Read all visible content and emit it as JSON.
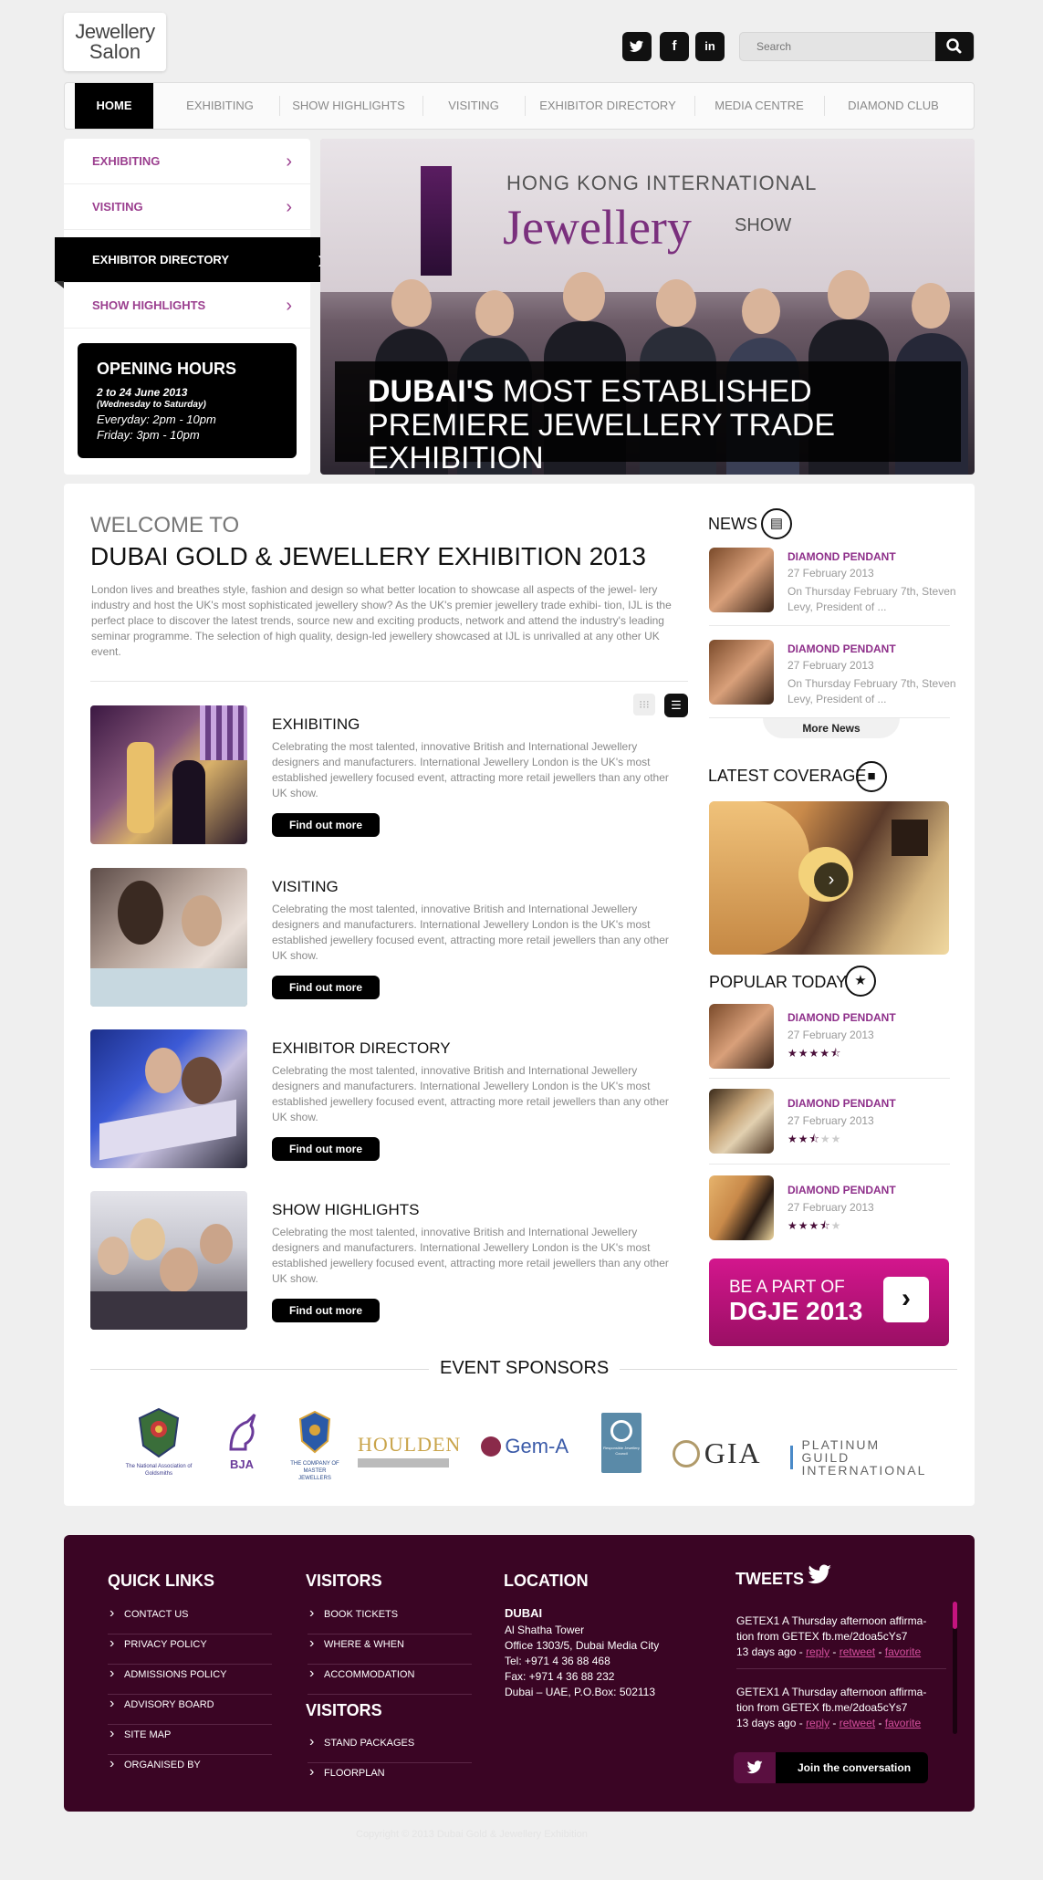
{
  "header": {
    "logo_line1": "Jewellery",
    "logo_line2": "Salon",
    "social": [
      "twitter",
      "facebook",
      "linkedin"
    ],
    "search_placeholder": "Search"
  },
  "nav": {
    "items": [
      "HOME",
      "EXHIBITING",
      "SHOW HIGHLIGHTS",
      "VISITING",
      "EXHIBITOR DIRECTORY",
      "MEDIA CENTRE",
      "DIAMOND CLUB"
    ],
    "active": "HOME"
  },
  "left_menu": {
    "items": [
      "EXHIBITING",
      "VISITING",
      "EXHIBITOR DIRECTORY",
      "SHOW HIGHLIGHTS"
    ],
    "active": "EXHIBITOR DIRECTORY"
  },
  "opening_hours": {
    "title": "OPENING HOURS",
    "dates": "2 to 24 June 2013",
    "sub": "(Wednesday to Saturday)",
    "everyday": "Everyday: 2pm - 10pm",
    "friday": "Friday: 3pm - 10pm"
  },
  "hero": {
    "banner_small": "HONG KONG INTERNATIONAL",
    "banner_big": "Jewellery",
    "banner_show": "SHOW",
    "line1_bold": "DUBAI'S",
    "line1_rest": " MOST ESTABLISHED",
    "line2": "PREMIERE JEWELLERY TRADE EXHIBITION"
  },
  "welcome": {
    "small": "WELCOME TO",
    "big": "DUBAI GOLD & JEWELLERY EXHIBITION 2013",
    "intro": "London lives and breathes style, fashion and design so what better location to showcase all aspects of the jewel- lery industry and host the UK's most sophisticated jewellery show? As the UK's premier jewellery trade exhibi- tion, IJL is the perfect place to discover the latest trends, source new and exciting products, network and attend the industry's leading seminar programme. The selection of high quality, design-led jewellery showcased at IJL is unrivalled at any other UK event."
  },
  "features": [
    {
      "title": "EXHIBITING",
      "desc": "Celebrating the most talented, innovative British and International Jewellery designers and manufacturers. International Jewellery London is the UK's most established jewellery focused event, attracting more retail jewellers than any other UK show.",
      "button": "Find out more"
    },
    {
      "title": "VISITING",
      "desc": "Celebrating the most talented, innovative British and International Jewellery designers and manufacturers. International Jewellery London is the UK's most established jewellery focused event, attracting more retail jewellers than any other UK show.",
      "button": "Find out more"
    },
    {
      "title": "EXHIBITOR DIRECTORY",
      "desc": "Celebrating the most talented, innovative British and International Jewellery designers and manufacturers. International Jewellery London is the UK's most established jewellery focused event, attracting more retail jewellers than any other UK show.",
      "button": "Find out more"
    },
    {
      "title": "SHOW HIGHLIGHTS",
      "desc": "Celebrating the most talented, innovative British and International Jewellery designers and manufacturers. International Jewellery London is the UK's most established jewellery focused event, attracting more retail jewellers than any other UK show.",
      "button": "Find out more"
    }
  ],
  "news": {
    "title": "NEWS",
    "items": [
      {
        "title": "DIAMOND PENDANT",
        "date": "27 February 2013",
        "excerpt": "On Thursday February 7th, Steven Levy, President of ..."
      },
      {
        "title": "DIAMOND PENDANT",
        "date": "27 February 2013",
        "excerpt": "On Thursday February 7th, Steven Levy, President of ..."
      }
    ],
    "more": "More News"
  },
  "coverage": {
    "title": "LATEST COVERAGE"
  },
  "popular": {
    "title": "POPULAR TODAY",
    "items": [
      {
        "title": "DIAMOND PENDANT",
        "date": "27 February 2013",
        "rating": 4.5
      },
      {
        "title": "DIAMOND PENDANT",
        "date": "27 February 2013",
        "rating": 2.5
      },
      {
        "title": "DIAMOND PENDANT",
        "date": "27 February 2013",
        "rating": 3.5
      }
    ]
  },
  "cta": {
    "line1": "BE A PART OF",
    "line2": "DGJE 2013"
  },
  "sponsors": {
    "title": "EVENT SPONSORS",
    "items": [
      "The National Association of Goldsmiths",
      "BJA",
      "THE COMPANY OF MASTER JEWELLERS",
      "HOULDEN",
      "Gem-A",
      "Responsible Jewellery Council",
      "GIA",
      "PLATINUM GUILD INTERNATIONAL"
    ]
  },
  "footer": {
    "quick_links_title": "QUICK LINKS",
    "quick_links": [
      "CONTACT US",
      "PRIVACY POLICY",
      "ADMISSIONS POLICY",
      "ADVISORY BOARD",
      "SITE MAP",
      "ORGANISED BY"
    ],
    "visitors_title": "VISITORS",
    "visitors_links": [
      "BOOK TICKETS",
      "WHERE & WHEN",
      "ACCOMMODATION"
    ],
    "visitors2_title": "VISITORS",
    "visitors2_links": [
      "STAND PACKAGES",
      "FLOORPLAN"
    ],
    "location_title": "LOCATION",
    "city": "DUBAI",
    "address": [
      "Al Shatha Tower",
      "Office 1303/5, Dubai Media City",
      "Tel: +971 4 36 88 468",
      "Fax: +971 4 36 88 232",
      "Dubai – UAE, P.O.Box: 502113"
    ],
    "tweets_title": "TWEETS",
    "tweets": [
      {
        "text": "GETEX1 A Thursday afternoon affirma- tion from GETEX fb.me/2doa5cYs7",
        "ago": "13 days ago",
        "reply": "reply",
        "retweet": "retweet",
        "favorite": "favorite"
      },
      {
        "text": "GETEX1 A Thursday afternoon affirma- tion from GETEX fb.me/2doa5cYs7",
        "ago": "13 days ago",
        "reply": "reply",
        "retweet": "retweet",
        "favorite": "favorite"
      }
    ],
    "join": "Join the conversation"
  },
  "copyright": "Copyright © 2013 Dubai Gold & Jewellery Exhibition",
  "colors": {
    "accent": "#9b3f8f",
    "footer_bg": "#3a0524",
    "cta": "#c5147f",
    "nav_active": "#000000"
  }
}
